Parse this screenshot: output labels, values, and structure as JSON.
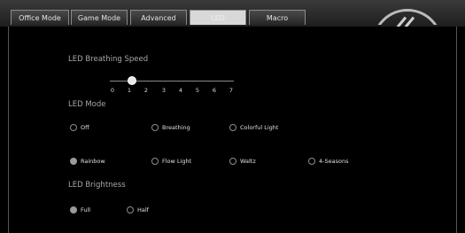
{
  "tabs": [
    {
      "label": "Office Mode"
    },
    {
      "label": "Game Mode"
    },
    {
      "label": "Advanced"
    },
    {
      "label": "LED"
    },
    {
      "label": "Macro"
    }
  ],
  "speed": {
    "title": "LED Breathing Speed",
    "ticks": [
      "0",
      "1",
      "2",
      "3",
      "4",
      "5",
      "6",
      "7"
    ],
    "value": 1
  },
  "mode": {
    "title": "LED Mode",
    "options": [
      {
        "label": "Off",
        "selected": false
      },
      {
        "label": "Breathing",
        "selected": false
      },
      {
        "label": "Colorful Light",
        "selected": false
      },
      {
        "label": "Rainbow",
        "selected": true
      },
      {
        "label": "Flow Light",
        "selected": false
      },
      {
        "label": "Waltz",
        "selected": false
      },
      {
        "label": "4-Seasons",
        "selected": false
      }
    ]
  },
  "brightness": {
    "title": "LED Brightness",
    "options": [
      {
        "label": "Full",
        "selected": true
      },
      {
        "label": "Half",
        "selected": false
      }
    ]
  }
}
